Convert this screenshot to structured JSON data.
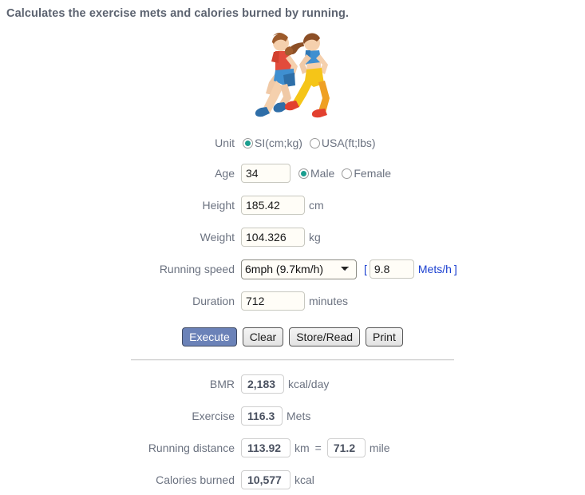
{
  "page": {
    "title": "Calculates the exercise mets and calories burned by running.",
    "illustration_name": "two-runners-illustration"
  },
  "form": {
    "unit": {
      "label": "Unit",
      "options": [
        {
          "label": "SI(cm;kg)",
          "selected": true
        },
        {
          "label": "USA(ft;lbs)",
          "selected": false
        }
      ]
    },
    "age": {
      "label": "Age",
      "value": "34",
      "gender_options": [
        {
          "label": "Male",
          "selected": true
        },
        {
          "label": "Female",
          "selected": false
        }
      ]
    },
    "height": {
      "label": "Height",
      "value": "185.42",
      "unit": "cm"
    },
    "weight": {
      "label": "Weight",
      "value": "104.326",
      "unit": "kg"
    },
    "running_speed": {
      "label": "Running speed",
      "selected": "6mph (9.7km/h)",
      "options": [
        "6mph (9.7km/h)"
      ],
      "bracket_left": "[",
      "mets_value": "9.8",
      "mets_link": "Mets/h",
      "bracket_right": "]"
    },
    "duration": {
      "label": "Duration",
      "value": "712",
      "unit": "minutes"
    }
  },
  "buttons": {
    "execute": "Execute",
    "clear": "Clear",
    "store_read": "Store/Read",
    "print": "Print"
  },
  "results": {
    "bmr": {
      "label": "BMR",
      "value": "2,183",
      "unit": "kcal/day"
    },
    "exercise": {
      "label": "Exercise",
      "value": "116.3",
      "unit": "Mets"
    },
    "distance": {
      "label": "Running distance",
      "value_km": "113.92",
      "unit_km": "km",
      "equals": "=",
      "value_mile": "71.2",
      "unit_mile": "mile"
    },
    "calories": {
      "label": "Calories burned",
      "value": "10,577",
      "unit": "kcal"
    }
  },
  "colors": {
    "accent_radio": "#1b9e8f",
    "link": "#1a3fd0",
    "primary_button": "#6b82b8",
    "label_text": "#6b7280",
    "result_text": "#4a5160"
  }
}
